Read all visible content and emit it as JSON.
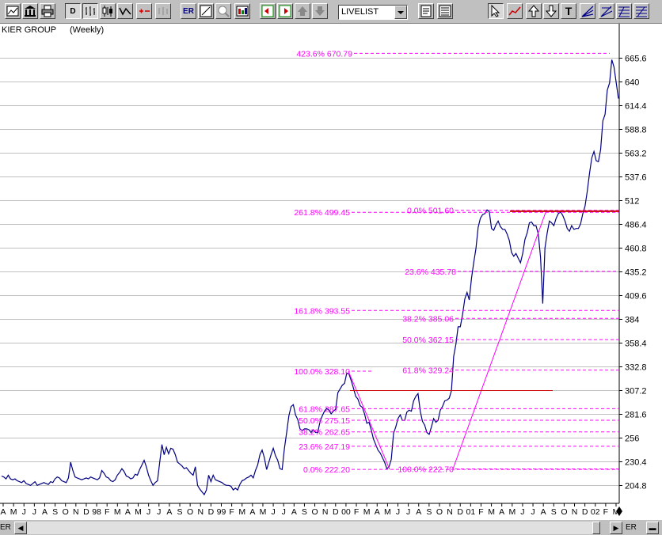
{
  "toolbar": {
    "buttons": [
      "chart-icon",
      "bank-icon",
      "print-icon",
      "daily-weekly-icon",
      "bar-chart-icon",
      "candle-icon",
      "line-icon",
      "plus-minus-icon",
      "scatter-icon",
      "er-button",
      "grid-icon",
      "zoom-icon",
      "color-icon",
      "arrow-left-icon",
      "arrow-right-icon",
      "up-lock-icon",
      "down-lock-icon",
      "save-icon",
      "settings-icon",
      "cursor-icon",
      "trend-icon",
      "arrow-up-icon",
      "arrow-down-icon",
      "text-icon",
      "fan-icon",
      "fib-icon",
      "fib-retrace-icon",
      "fib-ext-icon"
    ],
    "dw_label": "D",
    "er_label": "ER",
    "text_label": "T",
    "list_value": "LIVELIST"
  },
  "chart": {
    "title": "KIER GROUP",
    "subtitle": "(Weekly)"
  },
  "chart_data": {
    "type": "line",
    "title": "KIER GROUP",
    "subtitle": "(Weekly)",
    "y_ticks": [
      665.6,
      640,
      614.4,
      588.8,
      563.2,
      537.6,
      512,
      486.4,
      460.8,
      435.2,
      409.6,
      384,
      358.4,
      332.8,
      307.2,
      281.6,
      256,
      230.4,
      204.8
    ],
    "ylim": [
      192,
      685
    ],
    "x_ticks": [
      "A",
      "M",
      "J",
      "J",
      "A",
      "S",
      "O",
      "N",
      "D",
      "98",
      "F",
      "M",
      "A",
      "M",
      "J",
      "J",
      "A",
      "S",
      "O",
      "N",
      "D",
      "99",
      "F",
      "M",
      "A",
      "M",
      "J",
      "J",
      "A",
      "S",
      "O",
      "N",
      "D",
      "00",
      "F",
      "M",
      "A",
      "M",
      "J",
      "J",
      "A",
      "S",
      "O",
      "N",
      "D",
      "01",
      "F",
      "M",
      "A",
      "M",
      "J",
      "J",
      "A",
      "S",
      "O",
      "N",
      "D",
      "02",
      "F",
      "M"
    ],
    "series": [
      {
        "values": [
          215,
          214,
          212,
          216,
          212,
          211,
          212,
          210,
          209,
          208,
          210,
          207,
          206,
          205,
          207,
          209,
          205,
          206,
          207,
          208,
          207,
          206,
          209,
          208,
          212,
          214,
          213,
          210,
          209,
          208,
          213,
          230,
          221,
          214,
          213,
          212,
          211,
          212,
          213,
          212,
          214,
          213,
          212,
          211,
          213,
          221,
          218,
          214,
          213,
          210,
          209,
          211,
          216,
          219,
          223,
          220,
          215,
          214,
          212,
          213,
          217,
          216,
          222,
          227,
          232,
          225,
          216,
          210,
          205,
          208,
          210,
          230,
          249,
          238,
          246,
          239,
          245,
          244,
          238,
          230,
          228,
          226,
          223,
          224,
          221,
          218,
          216,
          225,
          205,
          201,
          198,
          195,
          200,
          216,
          209,
          216,
          211,
          210,
          209,
          208,
          206,
          205,
          205,
          204,
          200,
          202,
          200,
          206,
          210,
          211,
          213,
          214,
          216,
          213,
          221,
          227,
          238,
          243,
          235,
          222,
          230,
          238,
          245,
          237,
          232,
          223,
          222,
          245,
          262,
          280,
          290,
          292,
          281,
          276,
          266,
          264,
          266,
          266,
          265,
          262,
          265,
          262,
          262,
          274,
          280,
          285,
          288,
          286,
          282,
          285,
          287,
          305,
          309,
          313,
          315,
          326,
          325,
          318,
          310,
          301,
          298,
          291,
          289,
          282,
          272,
          273,
          265,
          255,
          249,
          243,
          240,
          235,
          230,
          223,
          225,
          233,
          261,
          268,
          277,
          281,
          275,
          275,
          284,
          286,
          285,
          296,
          301,
          304,
          285,
          274,
          270,
          262,
          260,
          268,
          277,
          273,
          275,
          286,
          290,
          296,
          297,
          299,
          307,
          344,
          357,
          376,
          376,
          389,
          406,
          413,
          405,
          428,
          445,
          460,
          483,
          493,
          497,
          498,
          502,
          500,
          482,
          480,
          486,
          490,
          484,
          481,
          481,
          476,
          469,
          456,
          452,
          455,
          450,
          445,
          455,
          470,
          477,
          488,
          489,
          485,
          485,
          476,
          451,
          401,
          461,
          477,
          490,
          488,
          485,
          493,
          498,
          500,
          496,
          490,
          482,
          479,
          485,
          481,
          482,
          482,
          487,
          498,
          506,
          522,
          541,
          558,
          565,
          555,
          554,
          567,
          598,
          605,
          631,
          639,
          664,
          656,
          639,
          622
        ]
      }
    ],
    "fib_levels": [
      {
        "label": "423.6% 670.79",
        "value": 670.79
      },
      {
        "label": "261.8% 499.45",
        "value": 499.45
      },
      {
        "label": "0.0% 501.60",
        "value": 501.6
      },
      {
        "label": "23.6% 435.78",
        "value": 435.78
      },
      {
        "label": "161.8% 393.55",
        "value": 393.55
      },
      {
        "label": "38.2% 385.06",
        "value": 385.06
      },
      {
        "label": "50.0% 362.15",
        "value": 362.15
      },
      {
        "label": "100.0% 328.10",
        "value": 328.1
      },
      {
        "label": "61.8% 329.24",
        "value": 329.24
      },
      {
        "label": "61.8% 287.65",
        "value": 287.65
      },
      {
        "label": "50.0% 275.15",
        "value": 275.15
      },
      {
        "label": "38.2% 262.65",
        "value": 262.65
      },
      {
        "label": "23.6% 247.19",
        "value": 247.19
      },
      {
        "label": "0.0% 222.20",
        "value": 222.2
      },
      {
        "label": "100.0% 222.70",
        "value": 222.7
      }
    ],
    "colors": {
      "price": "#000080",
      "fib": "#ff00ff",
      "trend": "#cc0000",
      "grid": "#c0c0c0"
    },
    "grid": true
  },
  "statusbar": {
    "left_label": "ER",
    "right_label": "ER"
  }
}
